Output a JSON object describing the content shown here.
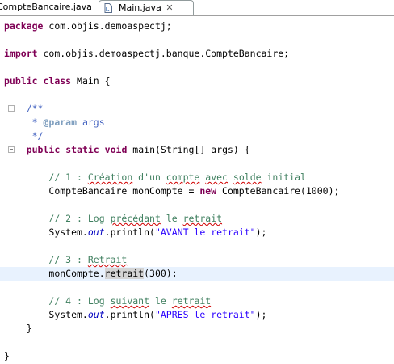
{
  "tabs": [
    {
      "label": "CompteBancaire.java",
      "active": false
    },
    {
      "label": "Main.java",
      "active": true,
      "close": "✕"
    }
  ],
  "code": {
    "package_kw": "package",
    "package_name": " com.objis.demoaspectj;",
    "import_kw": "import",
    "import_name": " com.objis.demoaspectj.banque.CompteBancaire;",
    "class_public": "public",
    "class_kw": "class",
    "class_name": " Main {",
    "jd_open": "/**",
    "jd_star": " * ",
    "jd_param_tag": "@param",
    "jd_param_name": " args",
    "jd_close": " */",
    "main_public": "public",
    "main_static": "static",
    "main_void": "void",
    "main_sig": " main(String[] args) {",
    "c1_a": "// 1 : ",
    "c1_w1": "Création",
    "c1_b": " d'un ",
    "c1_w2": "compte",
    "c1_c": " ",
    "c1_w3": "avec",
    "c1_d": " ",
    "c1_w4": "solde",
    "c1_e": " initial",
    "l1_a": "CompteBancaire monCompte = ",
    "l1_new": "new",
    "l1_b": " CompteBancaire(1000);",
    "c2_a": "// 2 : Log ",
    "c2_w1": "précédant",
    "c2_b": " le ",
    "c2_w2": "retrait",
    "l2_a": "System.",
    "l2_out": "out",
    "l2_b": ".println(",
    "l2_str": "\"AVANT le retrait\"",
    "l2_c": ");",
    "c3_a": "// 3 : ",
    "c3_w1": "Retrait",
    "l3_a": "monCompte.",
    "l3_mark": "retrait",
    "l3_b": "(300);",
    "c4_a": "// 4 : Log ",
    "c4_w1": "suivant",
    "c4_b": " le ",
    "c4_w2": "retrait",
    "l4_a": "System.",
    "l4_out": "out",
    "l4_b": ".println(",
    "l4_str": "\"APRES le retrait\"",
    "l4_c": ");",
    "close_method": "}",
    "close_class": "}"
  },
  "colors": {
    "keyword": "#7f0055",
    "comment": "#3f7f5f",
    "javadoc": "#3f5fbf",
    "string": "#2a00ff",
    "field": "#0000c0",
    "current_line": "#e8f2fe"
  }
}
